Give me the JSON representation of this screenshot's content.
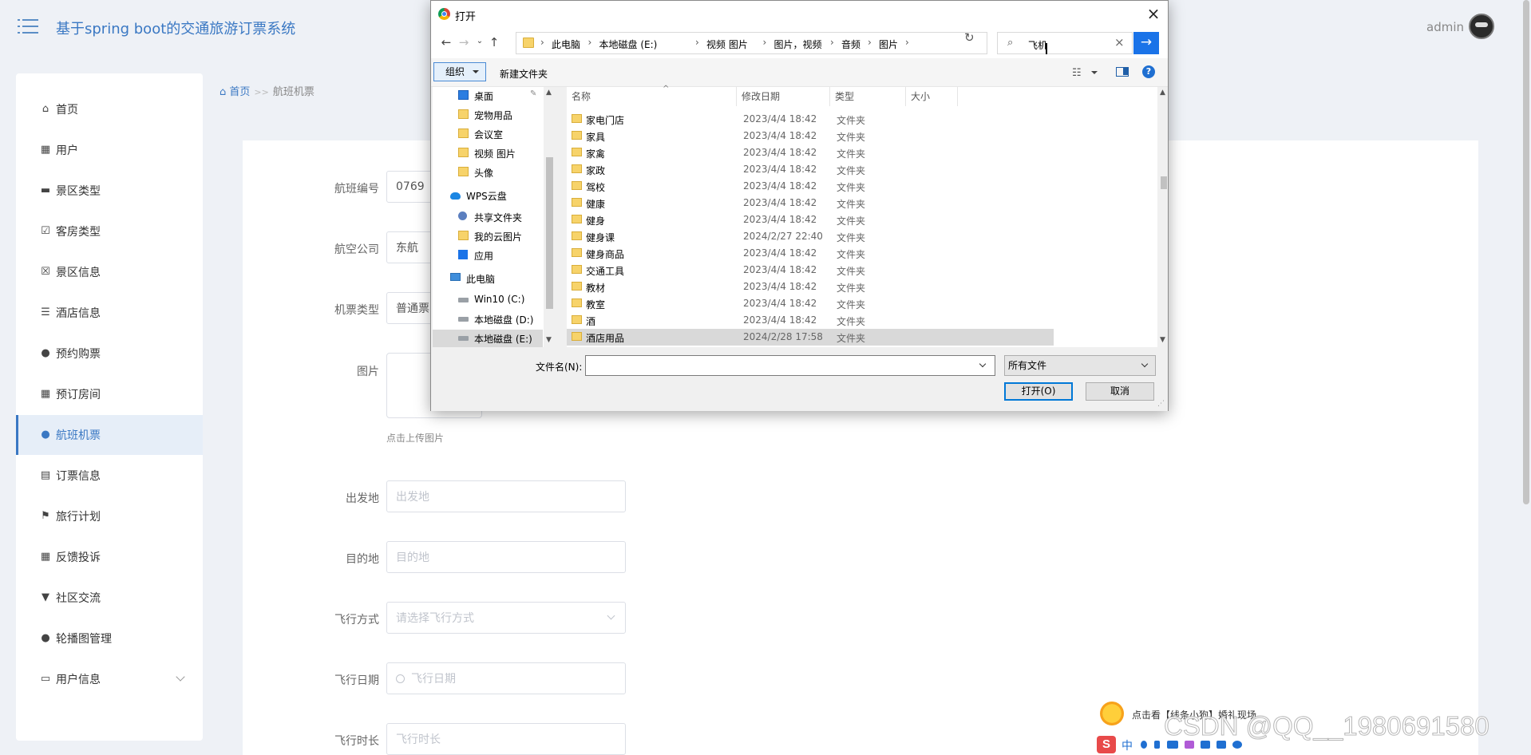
{
  "app": {
    "title": "基于spring boot的交通旅游订票系统",
    "user": "admin"
  },
  "sidebar": {
    "items": [
      {
        "label": "首页",
        "icon": "home-icon"
      },
      {
        "label": "用户",
        "icon": "grid-icon"
      },
      {
        "label": "景区类型",
        "icon": "chat-icon"
      },
      {
        "label": "客房类型",
        "icon": "checklist-icon"
      },
      {
        "label": "景区信息",
        "icon": "cancel-list-icon"
      },
      {
        "label": "酒店信息",
        "icon": "sliders-icon"
      },
      {
        "label": "预约购票",
        "icon": "user-icon"
      },
      {
        "label": "预订房间",
        "icon": "grid-icon"
      },
      {
        "label": "航班机票",
        "icon": "user-icon",
        "active": true
      },
      {
        "label": "订票信息",
        "icon": "clipboard-icon"
      },
      {
        "label": "旅行计划",
        "icon": "flag-icon"
      },
      {
        "label": "反馈投诉",
        "icon": "grid-icon"
      },
      {
        "label": "社区交流",
        "icon": "signpost-icon"
      },
      {
        "label": "轮播图管理",
        "icon": "pin-icon"
      },
      {
        "label": "用户信息",
        "icon": "window-icon"
      }
    ]
  },
  "breadcrumb": {
    "home": "首页",
    "sep": ">>",
    "current": "航班机票"
  },
  "form": {
    "flight_no_label": "航班编号",
    "flight_no_value": "0769",
    "airline_label": "航空公司",
    "airline_value": "东航",
    "ticket_type_label": "机票类型",
    "ticket_type_value": "普通票",
    "image_label": "图片",
    "upload_hint": "点击上传图片",
    "departure_label": "出发地",
    "departure_placeholder": "出发地",
    "destination_label": "目的地",
    "destination_placeholder": "目的地",
    "flight_mode_label": "飞行方式",
    "flight_mode_placeholder": "请选择飞行方式",
    "flight_date_label": "飞行日期",
    "flight_date_placeholder": "飞行日期",
    "duration_label": "飞行时长",
    "duration_placeholder": "飞行时长"
  },
  "dialog": {
    "title": "打开",
    "path": [
      "此电脑",
      "本地磁盘 (E:)",
      "视频 图片",
      "图片，视频",
      "音频",
      "图片"
    ],
    "search_value": "飞机",
    "organize": "组织",
    "new_folder": "新建文件夹",
    "columns": {
      "name": "名称",
      "date": "修改日期",
      "type": "类型",
      "size": "大小"
    },
    "tree": [
      {
        "label": "桌面",
        "icon": "desktop-icon",
        "indent": 1,
        "pinned": true
      },
      {
        "label": "宠物用品",
        "icon": "folder-icon",
        "indent": 1
      },
      {
        "label": "会议室",
        "icon": "folder-icon",
        "indent": 1
      },
      {
        "label": "视频 图片",
        "icon": "folder-icon",
        "indent": 1
      },
      {
        "label": "头像",
        "icon": "folder-icon",
        "indent": 1
      },
      {
        "label": "WPS云盘",
        "icon": "cloud-icon",
        "indent": 0
      },
      {
        "label": "共享文件夹",
        "icon": "share-icon",
        "indent": 1
      },
      {
        "label": "我的云图片",
        "icon": "folder-icon",
        "indent": 1
      },
      {
        "label": "应用",
        "icon": "apps-icon",
        "indent": 1
      },
      {
        "label": "此电脑",
        "icon": "pc-icon",
        "indent": 0
      },
      {
        "label": "Win10 (C:)",
        "icon": "drive-icon",
        "indent": 1
      },
      {
        "label": "本地磁盘 (D:)",
        "icon": "drive-icon",
        "indent": 1
      },
      {
        "label": "本地磁盘 (E:)",
        "icon": "drive-icon",
        "indent": 1,
        "selected": true
      }
    ],
    "files": [
      {
        "name": "家电门店",
        "date": "2023/4/4 18:42",
        "type": "文件夹"
      },
      {
        "name": "家具",
        "date": "2023/4/4 18:42",
        "type": "文件夹"
      },
      {
        "name": "家禽",
        "date": "2023/4/4 18:42",
        "type": "文件夹"
      },
      {
        "name": "家政",
        "date": "2023/4/4 18:42",
        "type": "文件夹"
      },
      {
        "name": "驾校",
        "date": "2023/4/4 18:42",
        "type": "文件夹"
      },
      {
        "name": "健康",
        "date": "2023/4/4 18:42",
        "type": "文件夹"
      },
      {
        "name": "健身",
        "date": "2023/4/4 18:42",
        "type": "文件夹"
      },
      {
        "name": "健身课",
        "date": "2024/2/27 22:40",
        "type": "文件夹"
      },
      {
        "name": "健身商品",
        "date": "2023/4/4 18:42",
        "type": "文件夹"
      },
      {
        "name": "交通工具",
        "date": "2023/4/4 18:42",
        "type": "文件夹"
      },
      {
        "name": "教材",
        "date": "2023/4/4 18:42",
        "type": "文件夹"
      },
      {
        "name": "教室",
        "date": "2023/4/4 18:42",
        "type": "文件夹"
      },
      {
        "name": "酒",
        "date": "2023/4/4 18:42",
        "type": "文件夹"
      },
      {
        "name": "酒店用品",
        "date": "2024/2/28 17:58",
        "type": "文件夹",
        "hover": true
      }
    ],
    "filename_label": "文件名(N):",
    "filename_value": "",
    "filetype_value": "所有文件",
    "open_button": "打开(O)",
    "cancel_button": "取消"
  },
  "overlay": {
    "ad_text": "点击看【线条小狗】婚礼现场",
    "watermark": "CSDN @QQ__1980691580",
    "ime_label": "中"
  },
  "colors": {
    "accent": "#3a78c3",
    "dialog_accent": "#1a73e8",
    "page_bg": "#eef1f6"
  }
}
